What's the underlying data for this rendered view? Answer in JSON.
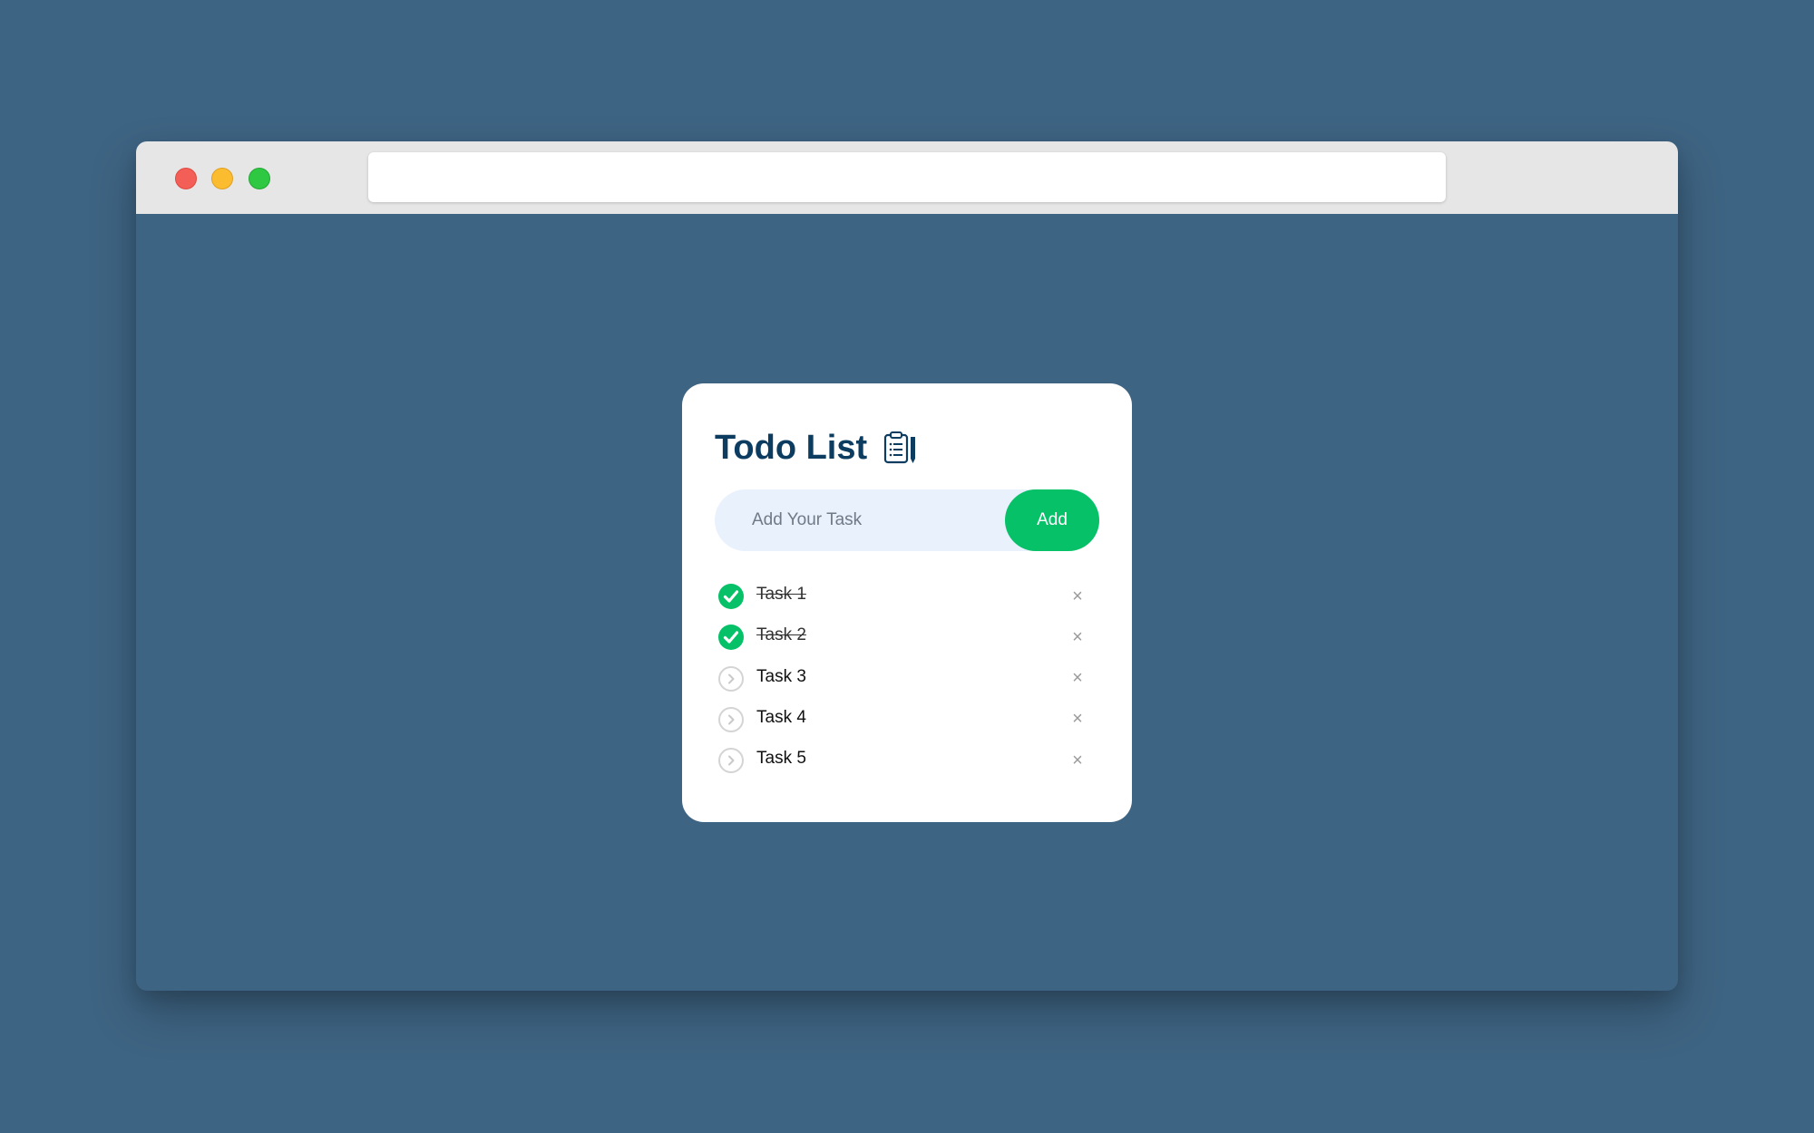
{
  "window": {
    "controls": [
      "close",
      "minimize",
      "maximize"
    ],
    "address_bar": ""
  },
  "app": {
    "title": "Todo List",
    "title_icon": "clipboard-icon",
    "input": {
      "value": "",
      "placeholder": "Add Your Task"
    },
    "add_label": "Add",
    "delete_glyph": "×",
    "tasks": [
      {
        "label": "Task 1",
        "done": true
      },
      {
        "label": "Task 2",
        "done": true
      },
      {
        "label": "Task 3",
        "done": false
      },
      {
        "label": "Task 4",
        "done": false
      },
      {
        "label": "Task 5",
        "done": false
      }
    ]
  },
  "colors": {
    "background": "#3e6483",
    "title": "#0d3c61",
    "accent": "#06c167",
    "input_bg": "#e9f1fd"
  }
}
